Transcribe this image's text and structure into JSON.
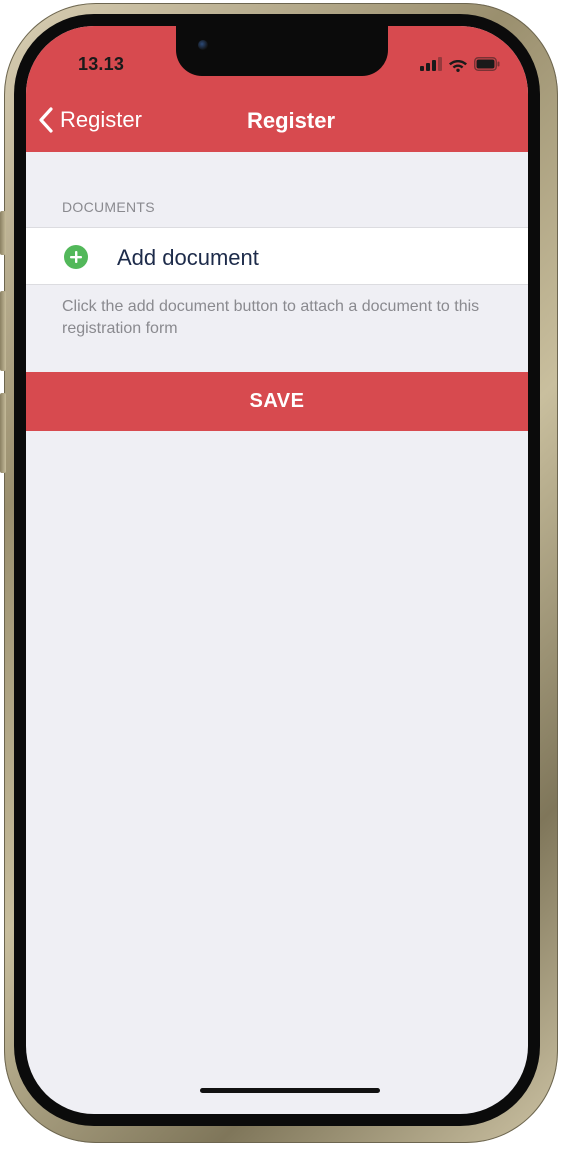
{
  "status_bar": {
    "time": "13.13",
    "signal_icon": "cellular-signal-icon",
    "wifi_icon": "wifi-icon",
    "battery_icon": "battery-icon"
  },
  "nav_bar": {
    "back_icon": "chevron-left-icon",
    "back_label": "Register",
    "title": "Register"
  },
  "documents": {
    "section_header": "DOCUMENTS",
    "add_icon": "plus-circle-icon",
    "add_label": "Add document",
    "help_text": "Click the add document button to attach a document to this registration form"
  },
  "actions": {
    "save_label": "SAVE"
  },
  "colors": {
    "accent_red": "#d74a4f",
    "add_green": "#52b85a",
    "background": "#efeff4",
    "row_text": "#1d2b4a",
    "secondary_text": "#8a8a8f"
  }
}
